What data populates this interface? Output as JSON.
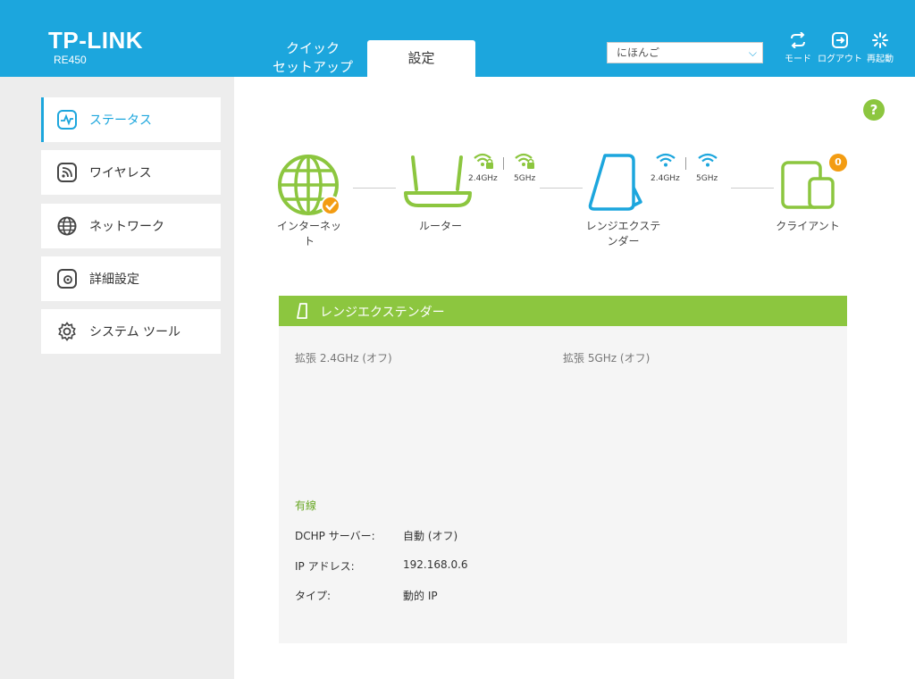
{
  "header": {
    "logo": "TP-LINK",
    "model": "RE450",
    "tabs": [
      "クイック\nセットアップ",
      "設定"
    ],
    "language": "にほんご",
    "buttons": {
      "mode": "モード",
      "logout": "ログアウト",
      "reboot": "再起動"
    }
  },
  "sidebar": {
    "items": [
      {
        "label": "ステータス",
        "icon": "status-icon"
      },
      {
        "label": "ワイヤレス",
        "icon": "wireless-icon"
      },
      {
        "label": "ネットワーク",
        "icon": "globe-icon"
      },
      {
        "label": "詳細設定",
        "icon": "advanced-icon"
      },
      {
        "label": "システム ツール",
        "icon": "gear-icon"
      }
    ]
  },
  "help": "?",
  "topology": {
    "internet": "インターネッ\nト",
    "router": "ルーター",
    "extender": "レンジエクステ\nンダー",
    "clients": "クライアント",
    "client_count": "0",
    "freq_24": "2.4GHz",
    "freq_5": "5GHz"
  },
  "panel": {
    "title": "レンジエクステンダー",
    "ext_24": "拡張 2.4GHz (オフ)",
    "ext_5": "拡張 5GHz (オフ)",
    "wired_title": "有線",
    "rows": [
      {
        "label": "DCHP サーバー:",
        "value": "自動 (オフ)"
      },
      {
        "label": "IP アドレス:",
        "value": "192.168.0.6"
      },
      {
        "label": "タイプ:",
        "value": "動的 IP"
      }
    ]
  },
  "colors": {
    "accent": "#1ca6dd",
    "green": "#8cc63f",
    "orange": "#f39c12"
  }
}
